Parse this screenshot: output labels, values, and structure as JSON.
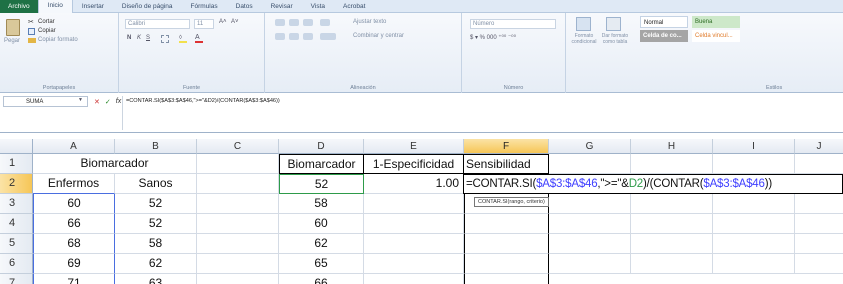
{
  "ribbon_tabs": [
    "Archivo",
    "Inicio",
    "Insertar",
    "Diseño de página",
    "Fórmulas",
    "Datos",
    "Revisar",
    "Vista",
    "Acrobat"
  ],
  "clipboard": {
    "paste": "Pegar",
    "cut": "Cortar",
    "copy": "Copiar",
    "format_painter": "Copiar formato",
    "group": "Portapapeles"
  },
  "font": {
    "name": "Calibri",
    "size": "11",
    "group": "Fuente",
    "bold": "N",
    "italic": "K",
    "underline": "S"
  },
  "alignment": {
    "wrap": "Ajustar texto",
    "merge": "Combinar y centrar",
    "group": "Alineación"
  },
  "number": {
    "format": "Número",
    "group": "Número"
  },
  "styles": {
    "conditional": "Formato condicional",
    "table": "Dar formato como tabla",
    "normal": "Normal",
    "good": "Buena",
    "calc": "Celda de co...",
    "linked": "Celda vincul...",
    "group": "Estilos"
  },
  "formula_bar": {
    "name_box": "SUMA",
    "formula": "=CONTAR.SI($A$3:$A$46,\">=\"&D2)/(CONTAR($A$3:$A$46))",
    "cancel": "✕",
    "enter": "✓",
    "fx": "fx"
  },
  "columns": [
    "A",
    "B",
    "C",
    "D",
    "E",
    "F",
    "G",
    "H",
    "I",
    "J"
  ],
  "rows": [
    "1",
    "2",
    "3",
    "4",
    "5",
    "6",
    "7"
  ],
  "cells": {
    "A1": "Biomarcador",
    "A2": "Enfermos",
    "B2": "Sanos",
    "A3": "60",
    "B3": "52",
    "A4": "66",
    "B4": "52",
    "A5": "68",
    "B5": "58",
    "A6": "69",
    "B6": "62",
    "A7": "71",
    "B7": "63",
    "D1": "Biomarcador",
    "E1": "1-Especificidad",
    "F1": "Sensibilidad",
    "D2": "52",
    "E2": "1.00",
    "D3": "58",
    "D4": "60",
    "D5": "62",
    "D6": "65",
    "D7": "66"
  },
  "edit_formula": {
    "p1": "=CONTAR.SI(",
    "r1": "$A$3:$A$46",
    "p2": ",\">=\"&",
    "r2": "D2",
    "p3": ")/(CONTAR(",
    "r3": "$A$3:$A$46",
    "p4": "))"
  },
  "tooltip": "CONTAR.SI(rango, criterio)",
  "colors": {
    "file_tab": "#1e7145",
    "selection": "#f6c657",
    "ref_blue": "#4040ff",
    "ref_green": "#2e9b4a"
  }
}
